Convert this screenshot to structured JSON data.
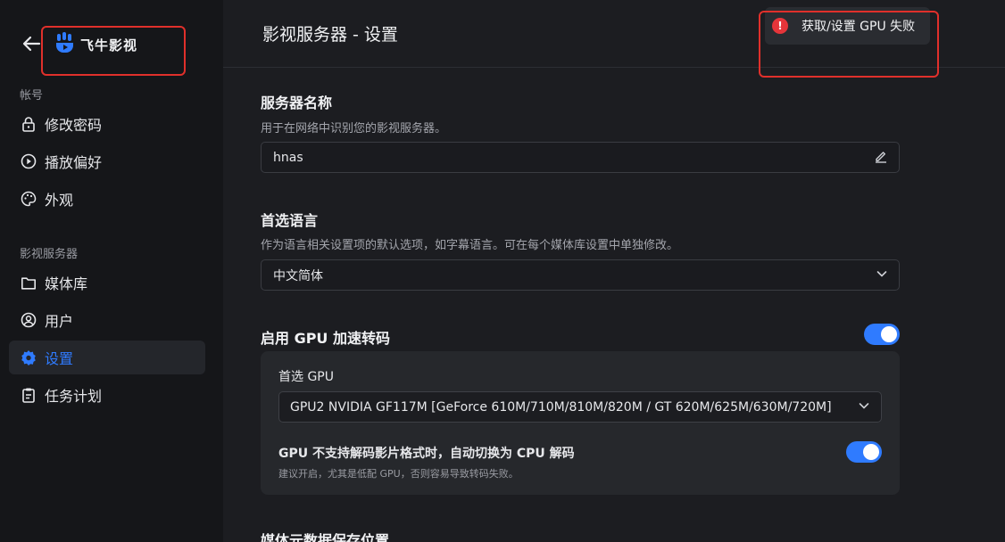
{
  "sidebar": {
    "brand": "飞牛影视",
    "sections": [
      {
        "title": "帐号"
      },
      {
        "title": "影视服务器"
      }
    ],
    "items": [
      {
        "label": "修改密码",
        "icon": "lock-icon"
      },
      {
        "label": "播放偏好",
        "icon": "play-circle-icon"
      },
      {
        "label": "外观",
        "icon": "palette-icon"
      },
      {
        "label": "媒体库",
        "icon": "folder-icon"
      },
      {
        "label": "用户",
        "icon": "user-icon"
      },
      {
        "label": "设置",
        "icon": "gear-icon",
        "active": true
      },
      {
        "label": "任务计划",
        "icon": "clipboard-icon"
      }
    ]
  },
  "header": {
    "title": "影视服务器 - 设置"
  },
  "toast": {
    "message": "获取/设置 GPU 失败",
    "icon": "error-icon"
  },
  "server_name": {
    "label": "服务器名称",
    "desc": "用于在网络中识别您的影视服务器。",
    "value": "hnas"
  },
  "language": {
    "label": "首选语言",
    "desc": "作为语言相关设置项的默认选项，如字幕语言。可在每个媒体库设置中单独修改。",
    "value": "中文简体"
  },
  "gpu": {
    "label": "启用 GPU 加速转码",
    "enabled": true,
    "preferred_label": "首选 GPU",
    "preferred_value": "GPU2 NVIDIA GF117M [GeForce 610M/710M/810M/820M / GT 620M/625M/630M/720M]",
    "fallback_label": "GPU 不支持解码影片格式时，自动切换为 CPU 解码",
    "fallback_desc": "建议开启，尤其是低配 GPU，否则容易导致转码失败。",
    "fallback_enabled": true
  },
  "metadata": {
    "label": "媒体元数据保存位置"
  },
  "colors": {
    "accent": "#2f7bff",
    "error": "#e5353a",
    "annotation": "#e0302b"
  }
}
